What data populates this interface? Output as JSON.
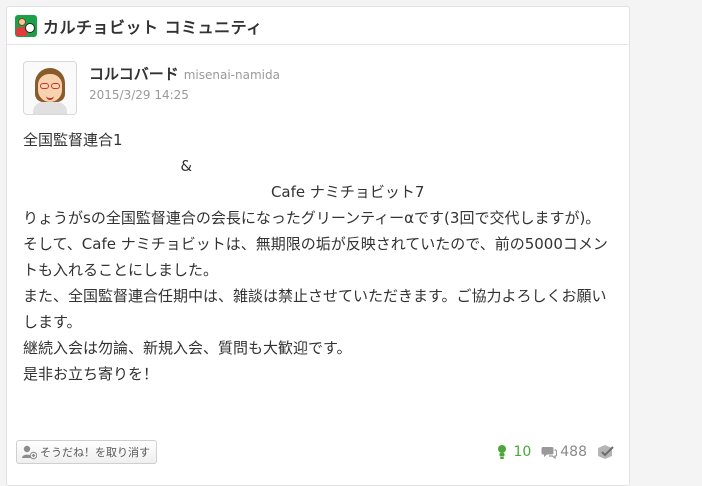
{
  "community": {
    "title": "カルチョビット コミュニティ",
    "icon": "calciobit-community-icon"
  },
  "post": {
    "author_name": "コルコバード",
    "author_id": "misenai-namida",
    "timestamp": "2015/3/29 14:25",
    "body_lines": [
      "全国監督連合1",
      "                                 &",
      "                                                    Cafe ナミチョビット7",
      "りょうがsの全国監督連合の会長になったグリーンティーαです(3回で交代しますが)。",
      "そして、Cafe ナミチョビットは、無期限の垢が反映されていたので、前の5000コメントも入れることにしました。",
      "また、全国監督連合任期中は、雑談は禁止させていただきます。ご協力よろしくお願いします。",
      "継続入会は勿論、新規入会、質問も大歓迎です。",
      "是非お立ち寄りを！"
    ]
  },
  "footer": {
    "empathy_button_label": "そうだね！を取り消す",
    "empathy_count": "10",
    "reply_count": "488",
    "colors": {
      "empathy": "#4aa83a",
      "muted": "#8a8a8a"
    },
    "icons": {
      "empathy_button": "add-empathy-icon",
      "empathy_count": "empathy-icon",
      "reply_count": "reply-bubble-icon",
      "checked": "read-check-icon"
    }
  }
}
